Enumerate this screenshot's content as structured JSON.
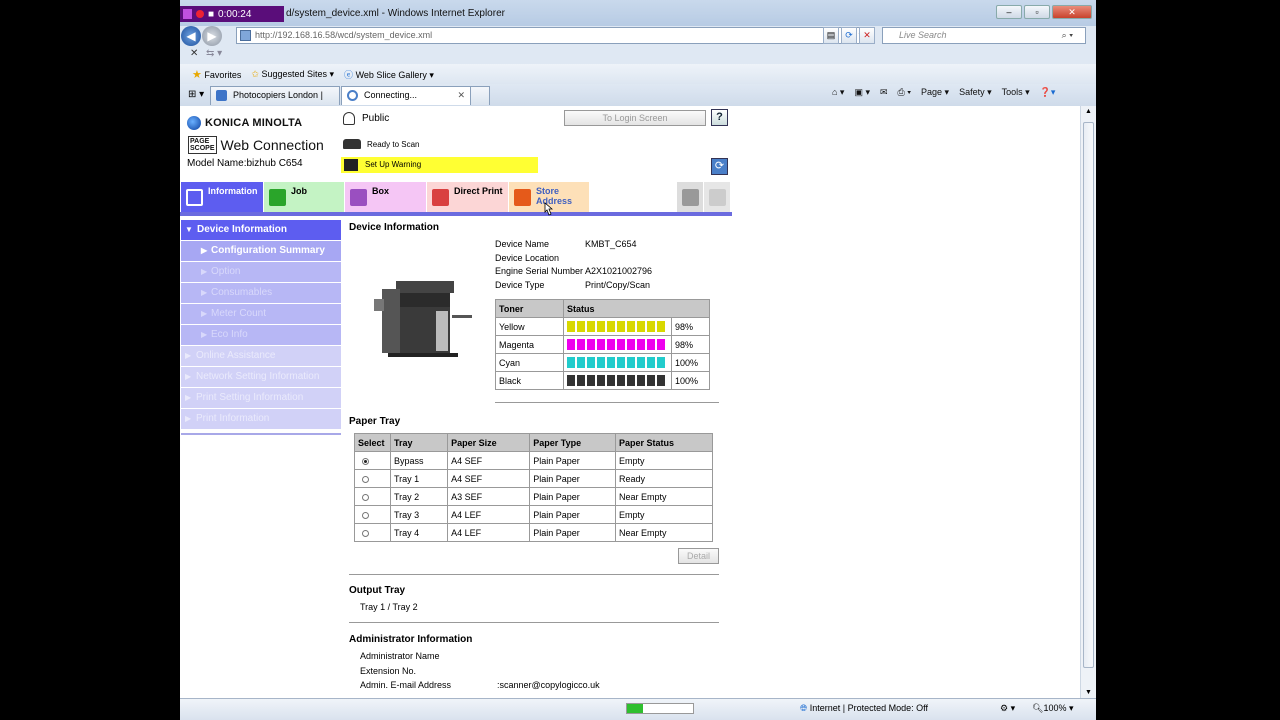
{
  "recorder": {
    "time": "0:00:24"
  },
  "window": {
    "title": "d/system_device.xml - Windows Internet Explorer"
  },
  "addressbar": {
    "url": "http://192.168.16.58/wcd/system_device.xml",
    "search_placeholder": "Live Search"
  },
  "favbar": {
    "favorites": "Favorites",
    "suggested": "Suggested Sites ▾",
    "webslice": "Web Slice Gallery ▾"
  },
  "tabs": [
    {
      "label": "Photocopiers London | Ph..."
    },
    {
      "label": "Connecting..."
    }
  ],
  "toolbar": {
    "page": "Page ▾",
    "safety": "Safety ▾",
    "tools": "Tools ▾"
  },
  "header": {
    "brand": "KONICA MINOLTA",
    "pagescope_a": "PAGE",
    "pagescope_b": "SCOPE",
    "webconn": "Web Connection",
    "model": "Model Name:bizhub C654",
    "user": "Public",
    "login": "To Login Screen",
    "help": "?",
    "ready": "Ready to Scan",
    "warning": "Set Up Warning"
  },
  "maintabs": [
    {
      "label": "Information",
      "color": "#5d5df0"
    },
    {
      "label": "Job",
      "color": "#c4f3c4"
    },
    {
      "label": "Box",
      "color": "#f5c6f5"
    },
    {
      "label": "Direct Print",
      "color": "#fcd6d6"
    },
    {
      "label": "Store Address",
      "color": "#fde0b8"
    }
  ],
  "sidebar": {
    "device_info": "Device Information",
    "items": [
      "Configuration Summary",
      "Option",
      "Consumables",
      "Meter Count",
      "Eco Info"
    ],
    "sections": [
      "Online Assistance",
      "Network Setting Information",
      "Print Setting Information",
      "Print Information"
    ]
  },
  "device": {
    "heading": "Device Information",
    "fields": [
      {
        "k": "Device Name",
        "v": "KMBT_C654"
      },
      {
        "k": "Device Location",
        "v": ""
      },
      {
        "k": "Engine Serial Number",
        "v": "A2X1021002796"
      },
      {
        "k": "Device Type",
        "v": "Print/Copy/Scan"
      }
    ]
  },
  "toner": {
    "headers": [
      "Toner",
      "Status"
    ],
    "rows": [
      {
        "name": "Yellow",
        "pct": "98%",
        "color": "#d8d800",
        "level": 0.98
      },
      {
        "name": "Magenta",
        "pct": "98%",
        "color": "#ee00ee",
        "level": 0.98
      },
      {
        "name": "Cyan",
        "pct": "100%",
        "color": "#22cccc",
        "level": 1.0
      },
      {
        "name": "Black",
        "pct": "100%",
        "color": "#333333",
        "level": 1.0
      }
    ]
  },
  "paper": {
    "heading": "Paper Tray",
    "headers": [
      "Select",
      "Tray",
      "Paper Size",
      "Paper Type",
      "Paper Status"
    ],
    "rows": [
      {
        "tray": "Bypass",
        "size": "A4 SEF",
        "type": "Plain Paper",
        "status": "Empty",
        "selected": true
      },
      {
        "tray": "Tray 1",
        "size": "A4 SEF",
        "type": "Plain Paper",
        "status": "Ready",
        "selected": false
      },
      {
        "tray": "Tray 2",
        "size": "A3 SEF",
        "type": "Plain Paper",
        "status": "Near Empty",
        "selected": false
      },
      {
        "tray": "Tray 3",
        "size": "A4 LEF",
        "type": "Plain Paper",
        "status": "Empty",
        "selected": false
      },
      {
        "tray": "Tray 4",
        "size": "A4 LEF",
        "type": "Plain Paper",
        "status": "Near Empty",
        "selected": false
      }
    ],
    "detail": "Detail"
  },
  "output": {
    "heading": "Output Tray",
    "value": "Tray 1 / Tray 2"
  },
  "admin": {
    "heading": "Administrator Information",
    "fields": [
      {
        "k": "Administrator Name",
        "v": ""
      },
      {
        "k": "Extension No.",
        "v": ""
      },
      {
        "k": "Admin. E-mail Address",
        "v": ":scanner@copylogicco.uk"
      }
    ]
  },
  "status": {
    "zone": "Internet | Protected Mode: Off",
    "zoom": "100%"
  }
}
